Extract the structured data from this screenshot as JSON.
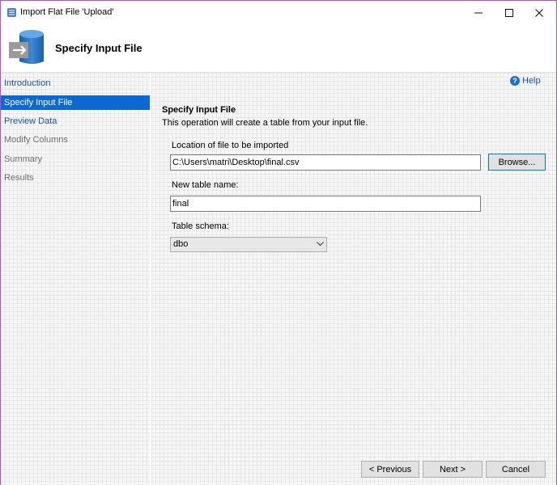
{
  "window": {
    "title": "Import Flat File 'Upload'",
    "controls": {
      "minimize": "—",
      "maximize": "☐",
      "close": "✕"
    }
  },
  "header": {
    "title": "Specify Input File",
    "icon": "database-import-icon"
  },
  "sidebar": {
    "items": [
      {
        "label": "Introduction",
        "state": "link"
      },
      {
        "label": "Specify Input File",
        "state": "active"
      },
      {
        "label": "Preview Data",
        "state": "link"
      },
      {
        "label": "Modify Columns",
        "state": "disabled"
      },
      {
        "label": "Summary",
        "state": "disabled"
      },
      {
        "label": "Results",
        "state": "disabled"
      }
    ]
  },
  "help": {
    "label": "Help",
    "icon": "help-icon"
  },
  "main": {
    "section_title": "Specify Input File",
    "section_desc": "This operation will create a table from your input file.",
    "file_location": {
      "label": "Location of file to be imported",
      "value": "C:\\Users\\matri\\Desktop\\final.csv"
    },
    "browse_label": "Browse...",
    "table_name": {
      "label": "New table name:",
      "value": "final"
    },
    "schema": {
      "label": "Table schema:",
      "value": "dbo"
    }
  },
  "footer": {
    "previous_label": "< Previous",
    "next_label": "Next >",
    "cancel_label": "Cancel"
  },
  "colors": {
    "accent": "#0c68d3",
    "link": "#1a53a8",
    "window_border": "#b64fb8"
  }
}
